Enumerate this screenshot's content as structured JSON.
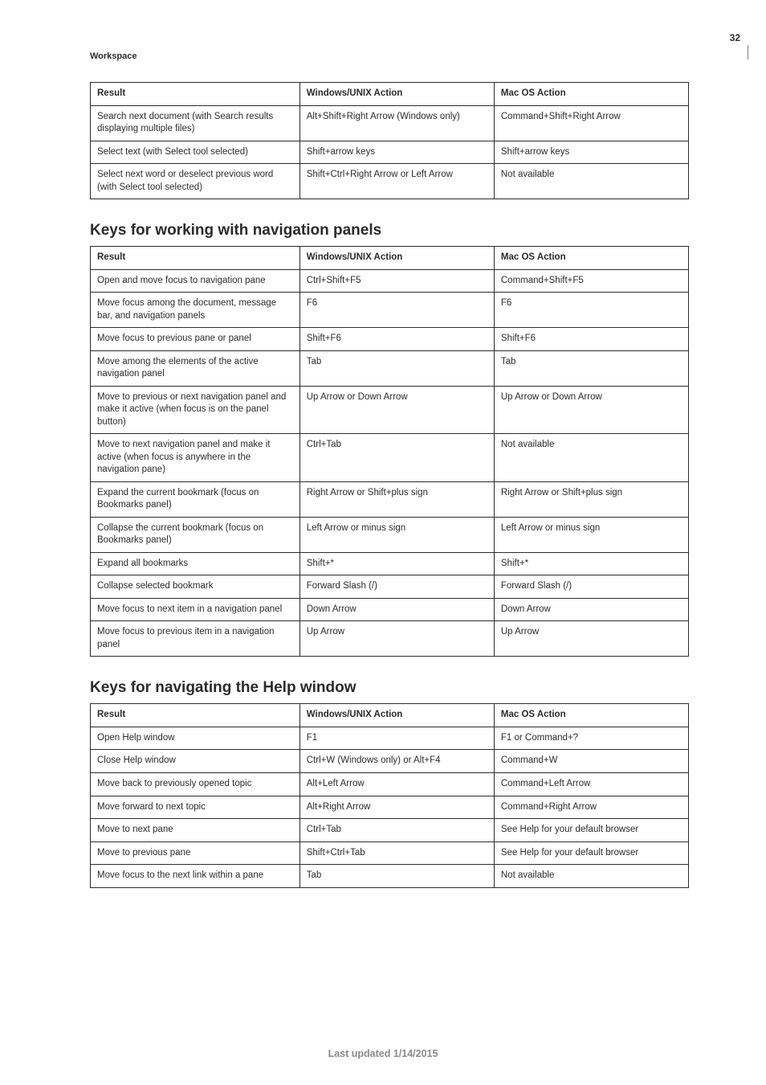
{
  "breadcrumb": "Workspace",
  "page_number": "32",
  "footer": "Last updated 1/14/2015",
  "tables": [
    {
      "heading": null,
      "cols": [
        "Result",
        "Windows/UNIX Action",
        "Mac OS Action"
      ],
      "rows": [
        [
          "Search next document (with Search results displaying multiple files)",
          "Alt+Shift+Right Arrow (Windows only)",
          "Command+Shift+Right Arrow"
        ],
        [
          "Select text (with Select tool selected)",
          "Shift+arrow keys",
          "Shift+arrow keys"
        ],
        [
          "Select next word or deselect previous word (with Select tool selected)",
          "Shift+Ctrl+Right Arrow or Left Arrow",
          "Not available"
        ]
      ]
    },
    {
      "heading": "Keys for working with navigation panels",
      "cols": [
        "Result",
        "Windows/UNIX Action",
        "Mac OS Action"
      ],
      "rows": [
        [
          "Open and move focus to navigation pane",
          "Ctrl+Shift+F5",
          "Command+Shift+F5"
        ],
        [
          "Move focus among the document, message bar, and navigation panels",
          "F6",
          "F6"
        ],
        [
          "Move focus to previous pane or panel",
          "Shift+F6",
          "Shift+F6"
        ],
        [
          "Move among the elements of the active navigation panel",
          "Tab",
          "Tab"
        ],
        [
          "Move to previous or next navigation panel and make it active (when focus is on the panel button)",
          "Up Arrow or Down Arrow",
          "Up Arrow or Down Arrow"
        ],
        [
          "Move to next navigation panel and make it active (when focus is anywhere in the navigation pane)",
          "Ctrl+Tab",
          "Not available"
        ],
        [
          "Expand the current bookmark (focus on Bookmarks panel)",
          "Right Arrow or Shift+plus sign",
          "Right Arrow or Shift+plus sign"
        ],
        [
          "Collapse the current bookmark (focus on Bookmarks panel)",
          "Left Arrow or minus sign",
          "Left Arrow or minus sign"
        ],
        [
          "Expand all bookmarks",
          "Shift+*",
          "Shift+*"
        ],
        [
          "Collapse selected bookmark",
          "Forward Slash (/)",
          "Forward Slash (/)"
        ],
        [
          "Move focus to next item in a navigation panel",
          "Down Arrow",
          "Down Arrow"
        ],
        [
          "Move focus to previous item in a navigation panel",
          "Up Arrow",
          "Up Arrow"
        ]
      ]
    },
    {
      "heading": "Keys for navigating the Help window",
      "cols": [
        "Result",
        "Windows/UNIX Action",
        "Mac OS Action"
      ],
      "rows": [
        [
          "Open Help window",
          "F1",
          "F1 or Command+?"
        ],
        [
          "Close Help window",
          "Ctrl+W (Windows only) or Alt+F4",
          "Command+W"
        ],
        [
          "Move back to previously opened topic",
          "Alt+Left Arrow",
          "Command+Left Arrow"
        ],
        [
          "Move forward to next topic",
          "Alt+Right Arrow",
          "Command+Right Arrow"
        ],
        [
          "Move to next pane",
          "Ctrl+Tab",
          "See Help for your default browser"
        ],
        [
          "Move to previous pane",
          "Shift+Ctrl+Tab",
          "See Help for your default browser"
        ],
        [
          "Move focus to the next link within a pane",
          "Tab",
          "Not available"
        ]
      ]
    }
  ]
}
